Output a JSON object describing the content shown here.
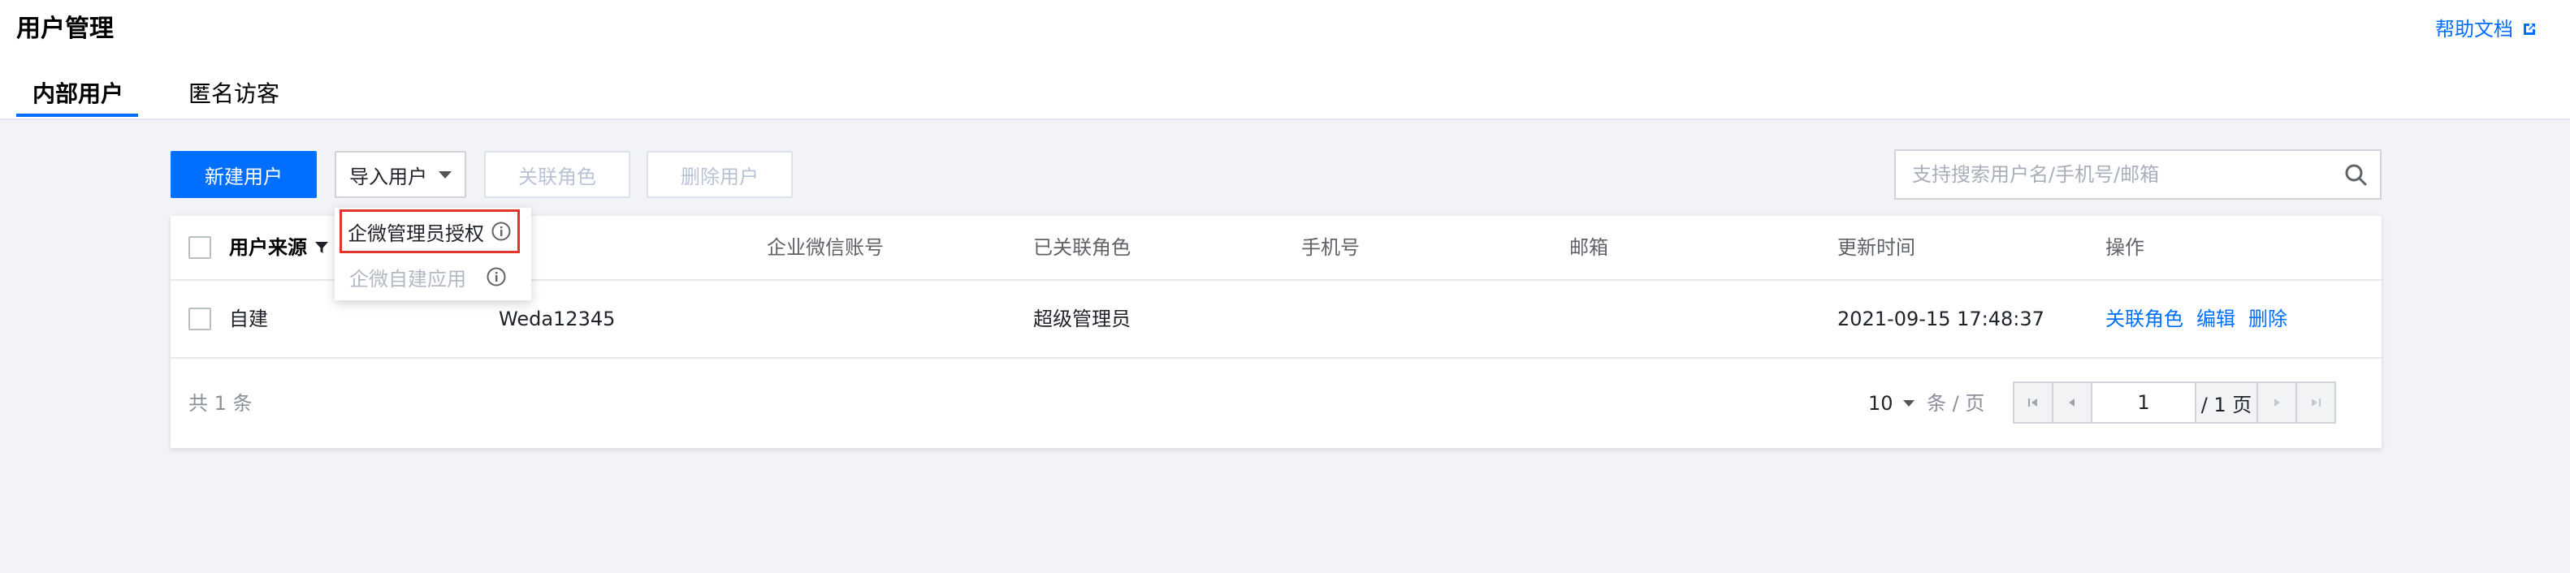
{
  "header": {
    "title": "用户管理",
    "help_label": "帮助文档",
    "tabs": [
      {
        "label": "内部用户"
      },
      {
        "label": "匿名访客"
      }
    ]
  },
  "toolbar": {
    "new_user": "新建用户",
    "import_user": "导入用户",
    "link_role": "关联角色",
    "delete_user": "删除用户",
    "search_placeholder": "支持搜索用户名/手机号/邮箱"
  },
  "import_menu": {
    "items": [
      {
        "label": "企微管理员授权"
      },
      {
        "label": "企微自建应用"
      }
    ]
  },
  "table": {
    "columns": [
      "用户来源",
      "",
      "企业微信账号",
      "已关联角色",
      "手机号",
      "邮箱",
      "更新时间",
      "操作"
    ],
    "rows": [
      {
        "source": "自建",
        "username": "Weda12345",
        "wecom_account": "",
        "roles": "超级管理员",
        "phone": "",
        "email": "",
        "updated_at": "2021-09-15 17:48:37",
        "actions": [
          "关联角色",
          "编辑",
          "删除"
        ]
      }
    ]
  },
  "pagination": {
    "total_label": "共 1 条",
    "page_size": "10",
    "per_page_label": "条 / 页",
    "current_page": "1",
    "total_pages_label": "/ 1 页"
  },
  "colors": {
    "primary": "#006eff",
    "highlight_border": "#e0362b",
    "background": "#f2f3f7"
  }
}
